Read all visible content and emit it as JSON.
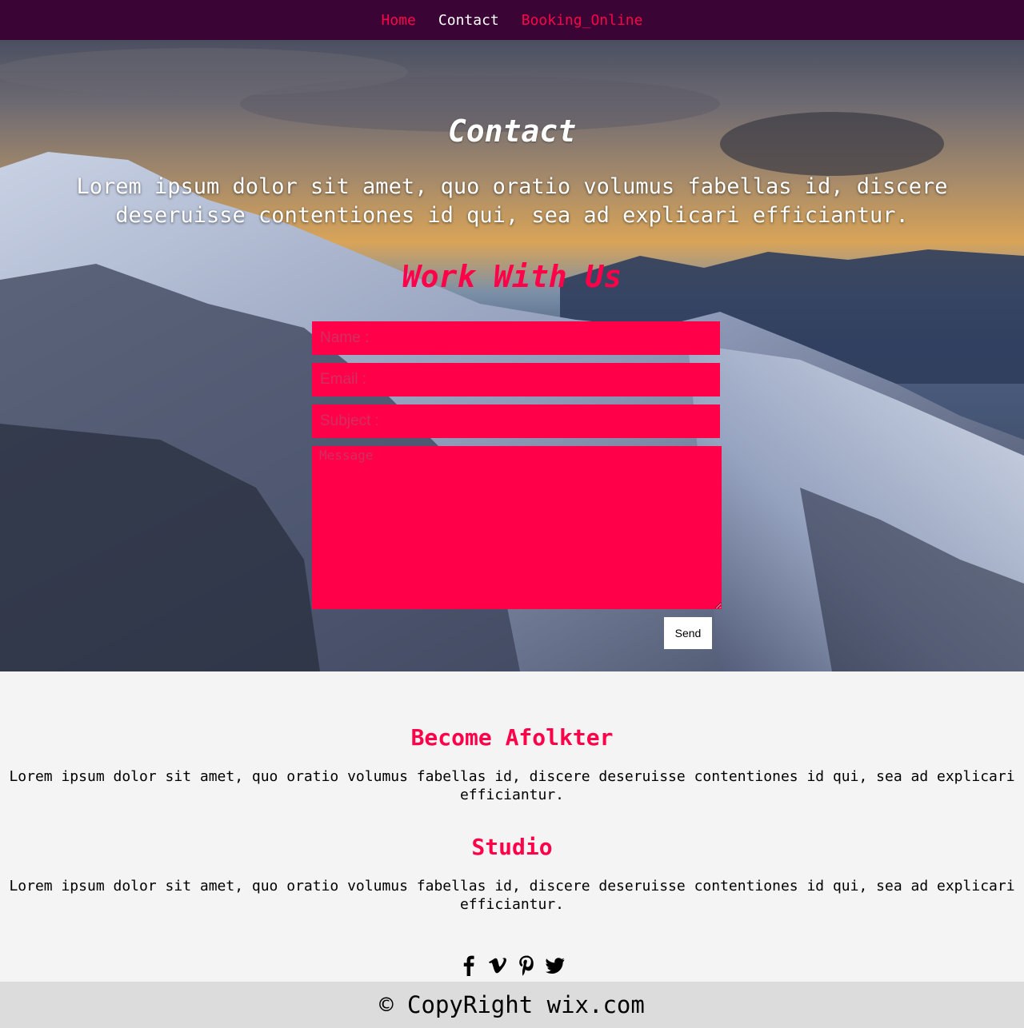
{
  "nav": {
    "items": [
      {
        "label": "Home",
        "active": false
      },
      {
        "label": "Contact",
        "active": true
      },
      {
        "label": "Booking_Online",
        "active": false
      }
    ]
  },
  "hero": {
    "title": "Contact",
    "text": "Lorem ipsum dolor sit amet, quo oratio volumus fabellas id, discere deseruisse contentiones id qui, sea ad explicari efficiantur.",
    "work_title": "Work With Us"
  },
  "form": {
    "name_placeholder": "Name :",
    "email_placeholder": "Email :",
    "subject_placeholder": "Subject :",
    "message_placeholder": "Message",
    "send_label": "Send"
  },
  "sections": [
    {
      "title": "Become Afolkter",
      "text": "Lorem ipsum dolor sit amet, quo oratio volumus fabellas id, discere deseruisse contentiones id qui, sea ad explicari efficiantur."
    },
    {
      "title": "Studio",
      "text": "Lorem ipsum dolor sit amet, quo oratio volumus fabellas id, discere deseruisse contentiones id qui, sea ad explicari efficiantur."
    }
  ],
  "social": [
    "facebook-icon",
    "vimeo-icon",
    "pinterest-icon",
    "twitter-icon"
  ],
  "footer": {
    "text": "© CopyRight wix.com"
  },
  "colors": {
    "accent": "#ff0049",
    "nav_bg": "#3a0535",
    "footer_bg": "#dcdcdc",
    "page_bg": "#f4f4f4"
  }
}
